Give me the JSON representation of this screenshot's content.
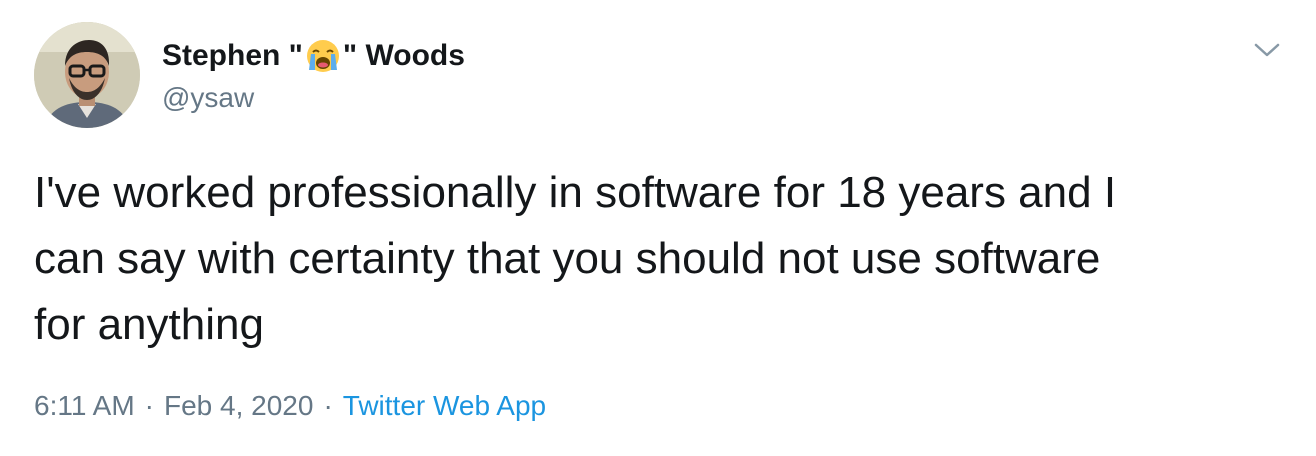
{
  "tweet": {
    "author": {
      "name_prefix": "Stephen \"",
      "name_emoji": "loudly-crying-face-emoji",
      "name_suffix": "\" Woods",
      "handle": "@ysaw",
      "avatar_icon": "avatar-photo"
    },
    "menu_icon": "chevron-down-icon",
    "text": "I've worked professionally in software for 18 years and I\ncan say with certainty that you should not use software\nfor anything",
    "meta": {
      "time": "6:11 AM",
      "separator": "·",
      "date": "Feb 4, 2020",
      "source": "Twitter Web App"
    },
    "colors": {
      "text": "#14171a",
      "secondary": "#657786",
      "link": "#1b95e0"
    }
  }
}
